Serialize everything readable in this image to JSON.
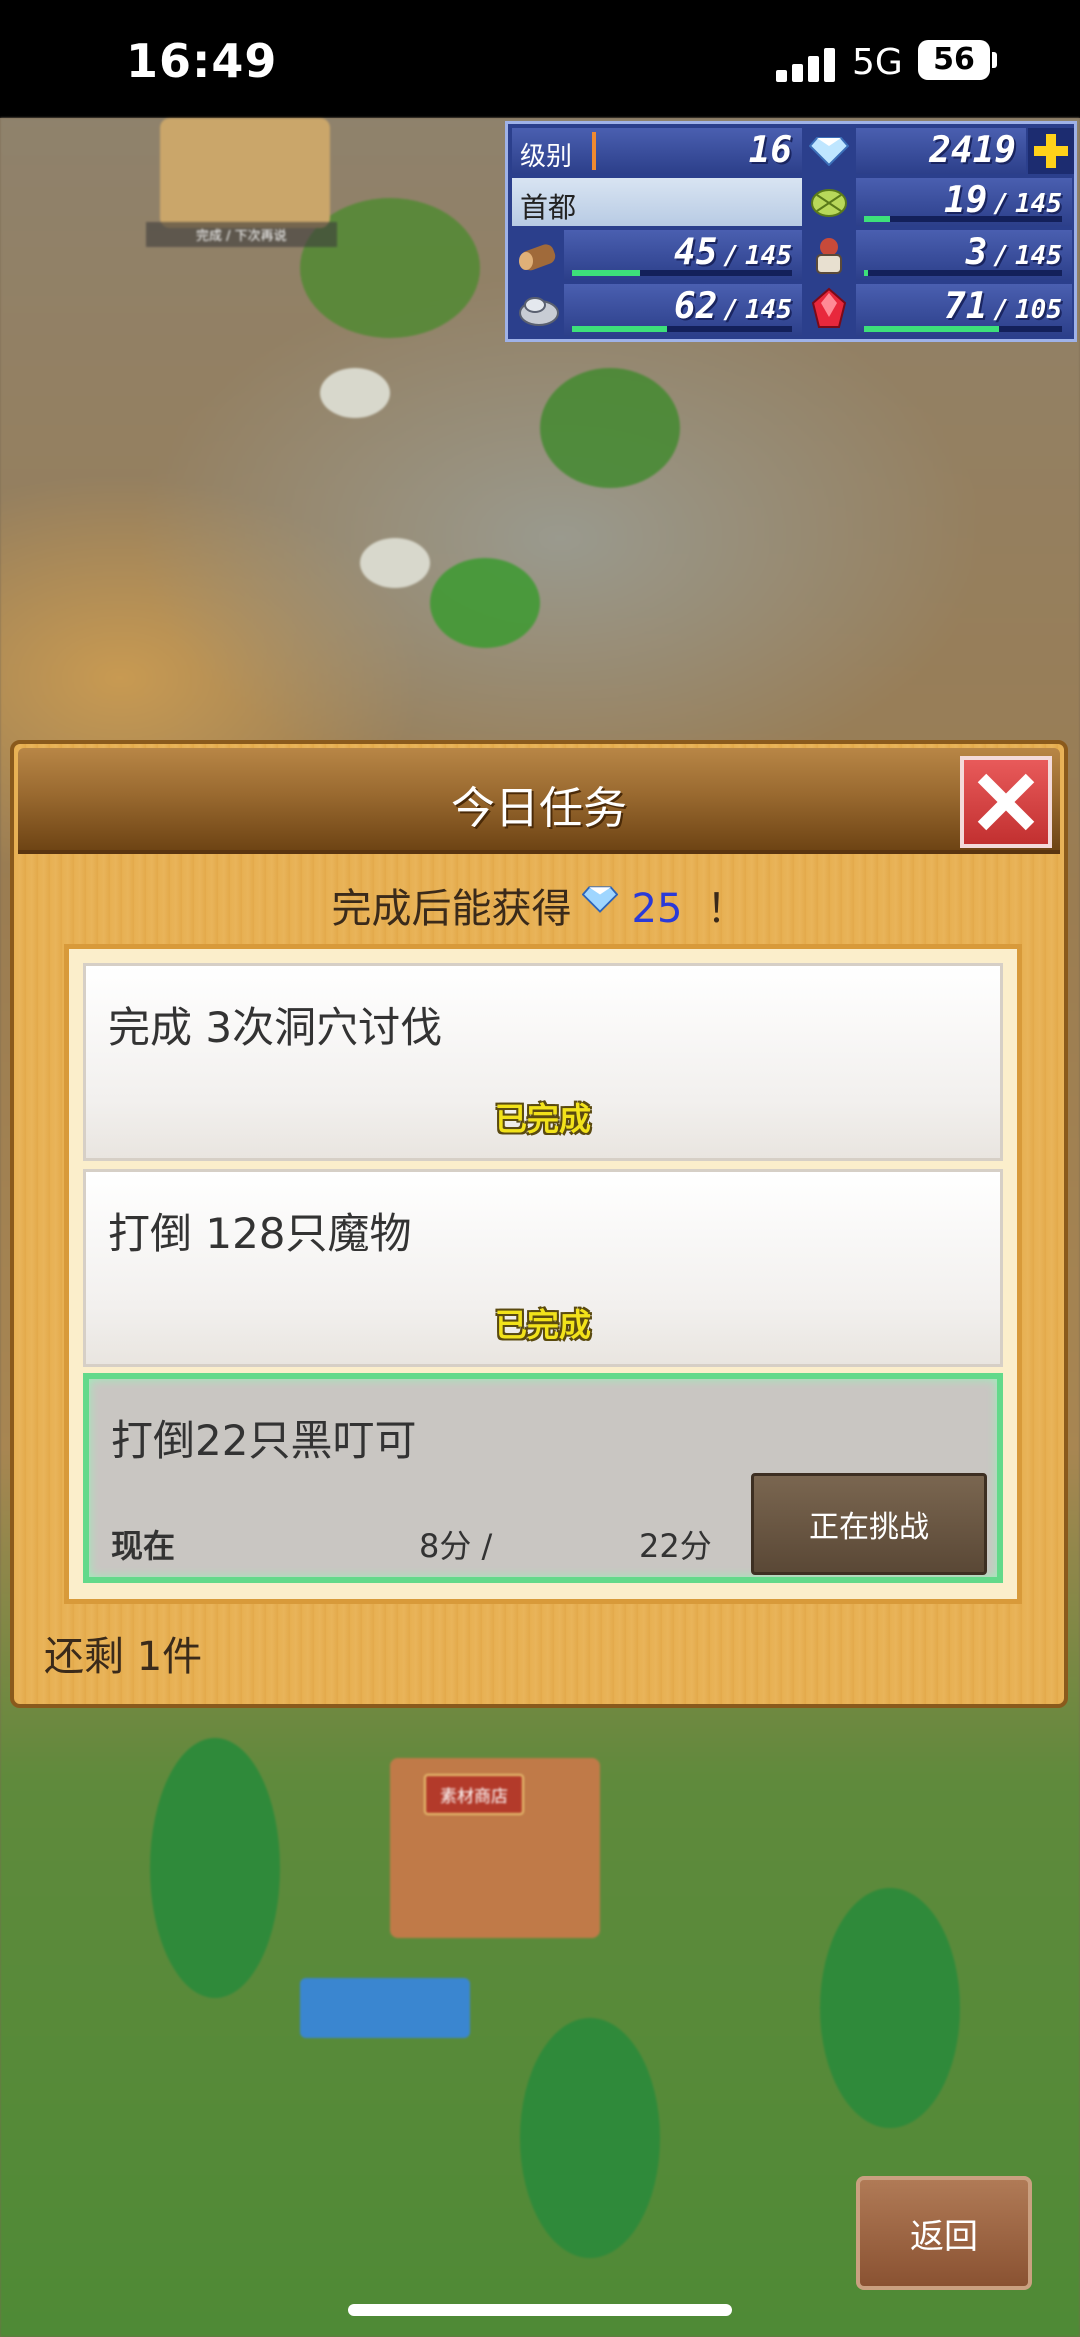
{
  "status_bar": {
    "time": "16:49",
    "network": "5G",
    "battery": "56"
  },
  "map": {
    "top_hint": "完成 / 下次再说",
    "shop_label": "素材商店"
  },
  "hud": {
    "level_label": "级别",
    "level_value": "16",
    "gems": "2419",
    "location": "首都",
    "wood": {
      "current": "45",
      "max": "145",
      "fill": 0.31
    },
    "food": {
      "current": "19",
      "max": "145",
      "fill": 0.13
    },
    "population": {
      "current": "3",
      "max": "145",
      "fill": 0.02
    },
    "stone": {
      "current": "62",
      "max": "145",
      "fill": 0.43
    },
    "ore": {
      "current": "71",
      "max": "105",
      "fill": 0.68
    },
    "colors": {
      "bar_fill": "#3de07a",
      "panel": "#2b3f8c"
    }
  },
  "dialog": {
    "title": "今日任务",
    "reward_prefix": "完成后能获得",
    "reward_amount": "25",
    "reward_suffix": "！",
    "missions": [
      {
        "text": "完成 3次洞穴讨伐",
        "status": "已完成"
      },
      {
        "text": "打倒 128只魔物",
        "status": "已完成"
      },
      {
        "text": "打倒22只黑叮可",
        "progress_label": "现在",
        "current": "8分 /",
        "target": "22分",
        "button": "正在挑战"
      }
    ],
    "remaining": "还剩 1件"
  },
  "back_button": "返回"
}
